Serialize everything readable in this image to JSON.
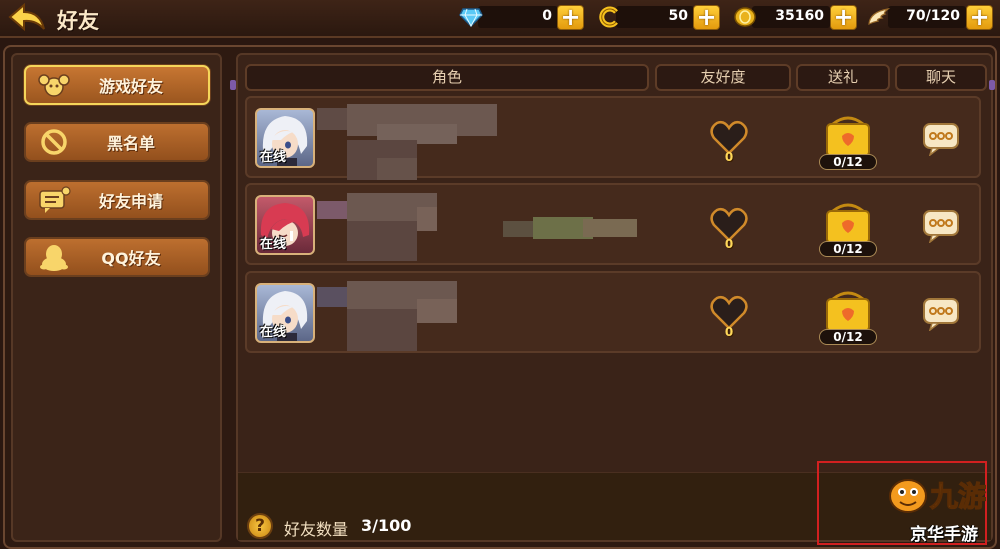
{
  "header": {
    "title": "好友",
    "resources": [
      {
        "name": "diamond",
        "icon": "diamond-icon",
        "value": "0"
      },
      {
        "name": "coin-c",
        "icon": "c-coin-icon",
        "value": "50"
      },
      {
        "name": "gold",
        "icon": "gold-coin-icon",
        "value": "35160"
      },
      {
        "name": "stamina",
        "icon": "wing-icon",
        "value": "70/120"
      }
    ],
    "plus_label": "+"
  },
  "sidebar": {
    "items": [
      {
        "label": "游戏好友",
        "icon": "friends-paw-icon",
        "active": true
      },
      {
        "label": "黑名单",
        "icon": "ban-icon",
        "active": false
      },
      {
        "label": "好友申请",
        "icon": "message-request-icon",
        "active": false
      },
      {
        "label": "QQ好友",
        "icon": "qq-penguin-icon",
        "active": false
      }
    ]
  },
  "table": {
    "columns": [
      "角色",
      "友好度",
      "送礼",
      "聊天"
    ],
    "rows": [
      {
        "status": "在线",
        "avatar": "white-hair-avatar",
        "friendship": "0",
        "gifts": "0/12"
      },
      {
        "status": "在线",
        "avatar": "red-hair-avatar",
        "friendship": "0",
        "gifts": "0/12"
      },
      {
        "status": "在线",
        "avatar": "white-hair-avatar",
        "friendship": "0",
        "gifts": "0/12"
      }
    ]
  },
  "footer": {
    "help": "?",
    "count_label": "好友数量",
    "count_value": "3/100"
  },
  "watermark": {
    "logo": "九游",
    "text": "京华手游"
  },
  "colors": {
    "accent_gold": "#f5d65a",
    "button_orange": "#bd6f2f",
    "panel_bg": "#3a2318",
    "highlight_red": "#d22020"
  }
}
